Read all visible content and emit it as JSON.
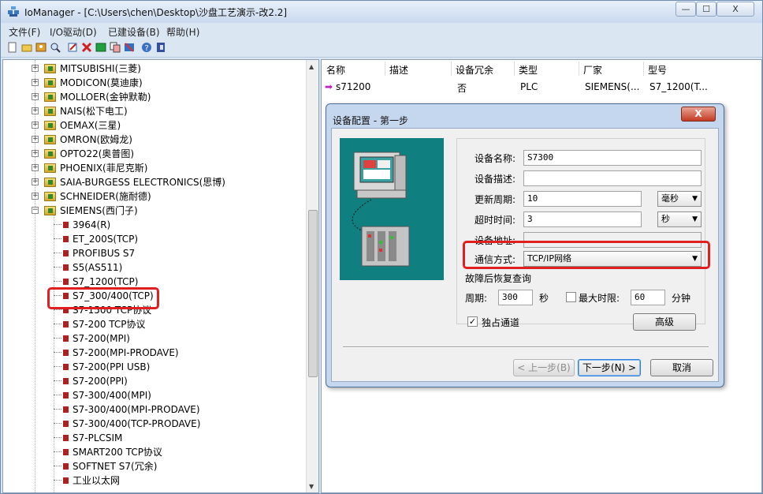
{
  "window": {
    "title": "IoManager - [C:\\Users\\chen\\Desktop\\沙盘工艺演示-改2.2]",
    "minimize_label": "—",
    "maximize_label": "☐",
    "close_label": "X"
  },
  "menu": [
    "文件(F)",
    "I/O驱动(D)",
    "已建设备(B)",
    "帮助(H)"
  ],
  "tree": {
    "vendors": [
      "MITSUBISHI(三菱)",
      "MODICON(莫迪康)",
      "MOLLOER(金钟默勒)",
      "NAIS(松下电工)",
      "OEMAX(三星)",
      "OMRON(欧姆龙)",
      "OPTO22(奥普图)",
      "PHOENIX(菲尼克斯)",
      "SAIA-BURGESS ELECTRONICS(思博)",
      "SCHNEIDER(施耐德)",
      "SIEMENS(西门子)"
    ],
    "vendor_expanders": [
      "+",
      "+",
      "+",
      "+",
      "+",
      "+",
      "+",
      "+",
      "+",
      "+",
      "−"
    ],
    "siemens_children": [
      "3964(R)",
      "ET_200S(TCP)",
      "PROFIBUS S7",
      "S5(AS511)",
      "S7_1200(TCP)",
      "S7_300/400(TCP)",
      "S7-1500 TCP协议",
      "S7-200 TCP协议",
      "S7-200(MPI)",
      "S7-200(MPI-PRODAVE)",
      "S7-200(PPI USB)",
      "S7-200(PPI)",
      "S7-300/400(MPI)",
      "S7-300/400(MPI-PRODAVE)",
      "S7-300/400(TCP-PRODAVE)",
      "S7-PLCSIM",
      "SMART200 TCP协议",
      "SOFTNET S7(冗余)",
      "工业以太网"
    ]
  },
  "device_list": {
    "headers": [
      "名称",
      "描述",
      "设备冗余",
      "类型",
      "厂家",
      "型号"
    ],
    "rows": [
      {
        "name": "s71200",
        "desc": "",
        "redundant": "否",
        "type": "PLC",
        "vendor": "SIEMENS(...",
        "model": "S7_1200(T..."
      }
    ]
  },
  "dialog": {
    "title": "设备配置 - 第一步",
    "close_label": "X",
    "labels": {
      "device_name": "设备名称:",
      "device_desc": "设备描述:",
      "update_period": "更新周期:",
      "timeout": "超时时间:",
      "device_address": "设备地址:",
      "comm_mode": "通信方式:",
      "fault_recovery": "故障后恢复查询",
      "period": "周期:",
      "seconds": "秒",
      "max_time_limit": "最大时限:",
      "minutes": "分钟",
      "exclusive_channel": "独占通道"
    },
    "values": {
      "device_name": "S7300",
      "device_desc": "",
      "update_period": "10",
      "update_unit": "毫秒",
      "timeout": "3",
      "timeout_unit": "秒",
      "device_address": "",
      "comm_mode": "TCP/IP网络",
      "period": "300",
      "max_time_limit": "60"
    },
    "checkboxes": {
      "max_time_limit_checked": "",
      "exclusive_channel_checked": "✓"
    },
    "buttons": {
      "advanced": "高级",
      "prev": "< 上一步(B)",
      "next": "下一步(N) >",
      "cancel": "取消"
    }
  },
  "colors": {
    "highlight": "#e02020",
    "illustration_bg": "#0f7f7f"
  }
}
